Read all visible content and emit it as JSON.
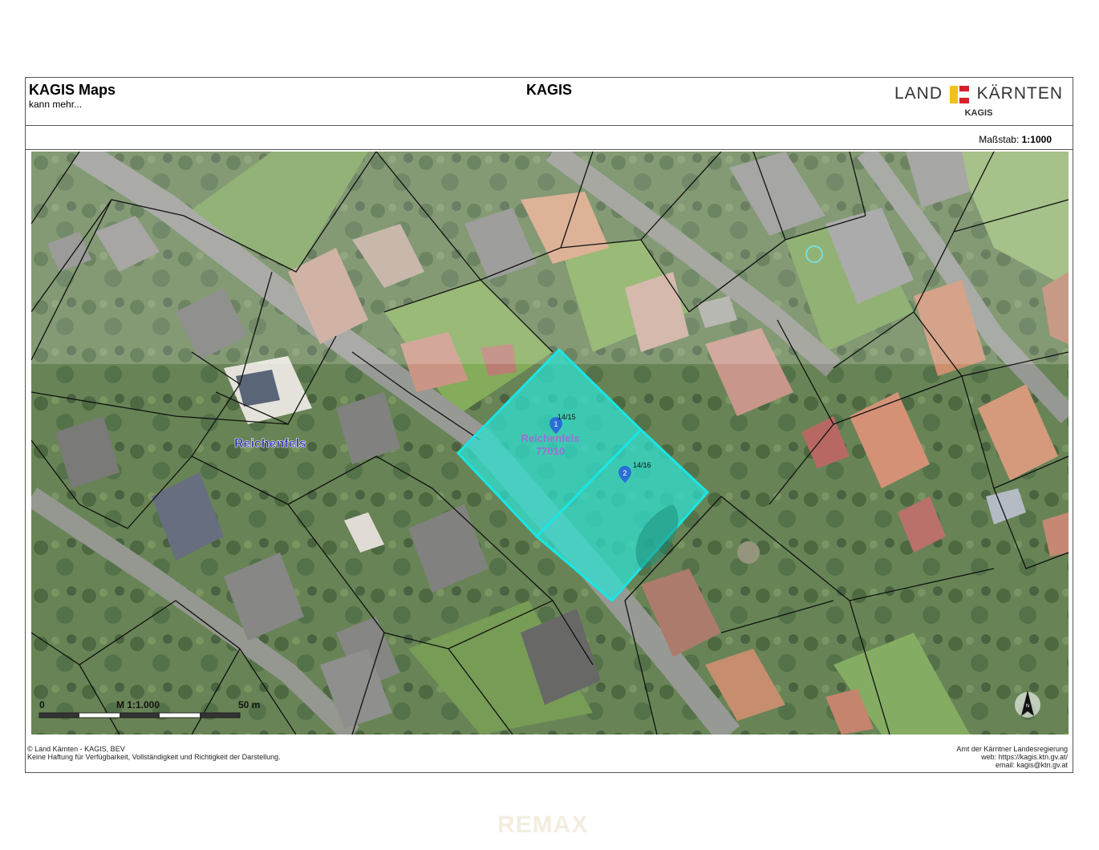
{
  "header": {
    "app_title": "KAGIS Maps",
    "app_subtitle": "kann mehr...",
    "center_title": "KAGIS",
    "logo": {
      "left": "LAND",
      "right": "KÄRNTEN",
      "sub": "KAGIS"
    }
  },
  "scale": {
    "label": "Maßstab:",
    "value": "1:1000"
  },
  "map": {
    "place_label": "Reichenfels",
    "parcel_area_label_1": "Reichenfels",
    "parcel_area_label_2": "77010",
    "markers": [
      {
        "number": "1",
        "parcel": "14/15"
      },
      {
        "number": "2",
        "parcel": "14/16"
      }
    ],
    "scalebar": {
      "start": "0",
      "middle": "M 1:1.000",
      "end": "50 m"
    },
    "north_arrow": "N",
    "colors": {
      "parcel_fill": "#2fe0d0",
      "parcel_stroke": "#19e6e6",
      "marker": "#2a6fd6",
      "place_label": "#1a1aa8"
    }
  },
  "footer": {
    "left_line1": "© Land Kärnten - KAGIS, BEV",
    "left_line2": "Keine Haftung für Verfügbarkeit, Vollständigkeit und Richtigkeit der Darstellung.",
    "right_line1": "Amt der Kärntner Landesregierung",
    "right_line2": "web: https://kagis.ktn.gv.at/",
    "right_line3": "email: kagis@ktn.gv.at"
  },
  "watermark": "REMAX"
}
